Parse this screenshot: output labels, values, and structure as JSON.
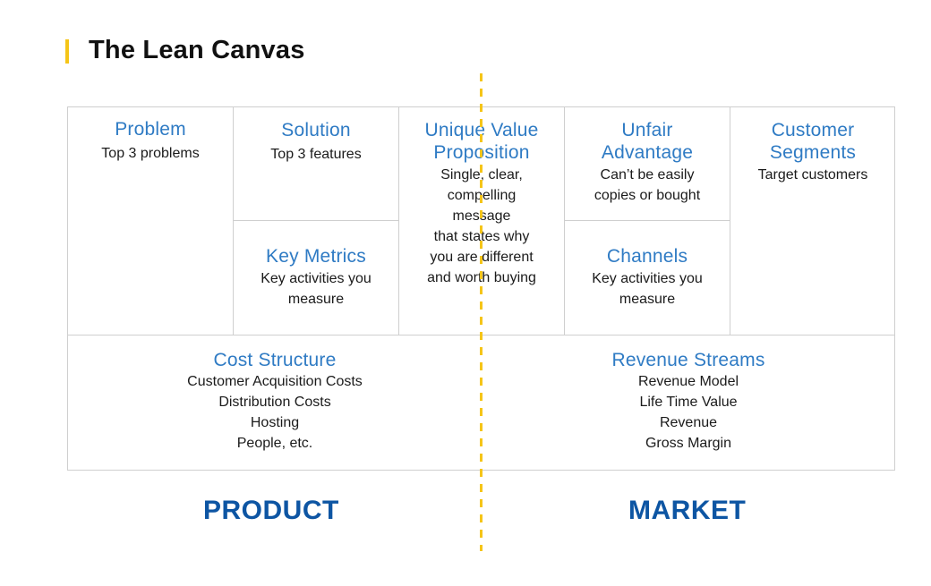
{
  "title": "The Lean Canvas",
  "colors": {
    "accent_bar": "#f5c518",
    "heading_blue": "#2f7bc4",
    "label_blue": "#0d55a3",
    "divider": "#f5c518",
    "border": "#cfcfcf"
  },
  "canvas": {
    "problem": {
      "heading": "Problem",
      "body": [
        "Top 3 problems"
      ]
    },
    "solution": {
      "heading": "Solution",
      "body": [
        "Top 3 features"
      ]
    },
    "key_metrics": {
      "heading": "Key Metrics",
      "body": [
        "Key activities you",
        "measure"
      ]
    },
    "uvp": {
      "heading": [
        "Unique Value",
        "Proposition"
      ],
      "body": [
        "Single, clear,",
        "compelling",
        "message",
        "that states why",
        "you are different",
        "and worth buying"
      ]
    },
    "unfair_advantage": {
      "heading": [
        "Unfair",
        "Advantage"
      ],
      "body": [
        "Can’t be easily",
        "copies or bought"
      ]
    },
    "channels": {
      "heading": "Channels",
      "body": [
        "Key activities you",
        "measure"
      ]
    },
    "customer_segments": {
      "heading": [
        "Customer",
        "Segments"
      ],
      "body": [
        "Target customers"
      ]
    },
    "cost_structure": {
      "heading": "Cost Structure",
      "body": [
        "Customer Acquisition Costs",
        "Distribution Costs",
        "Hosting",
        "People, etc."
      ]
    },
    "revenue_streams": {
      "heading": "Revenue Streams",
      "body": [
        "Revenue Model",
        "Life Time Value",
        "Revenue",
        "Gross Margin"
      ]
    }
  },
  "labels": {
    "left": "PRODUCT",
    "right": "MARKET"
  }
}
